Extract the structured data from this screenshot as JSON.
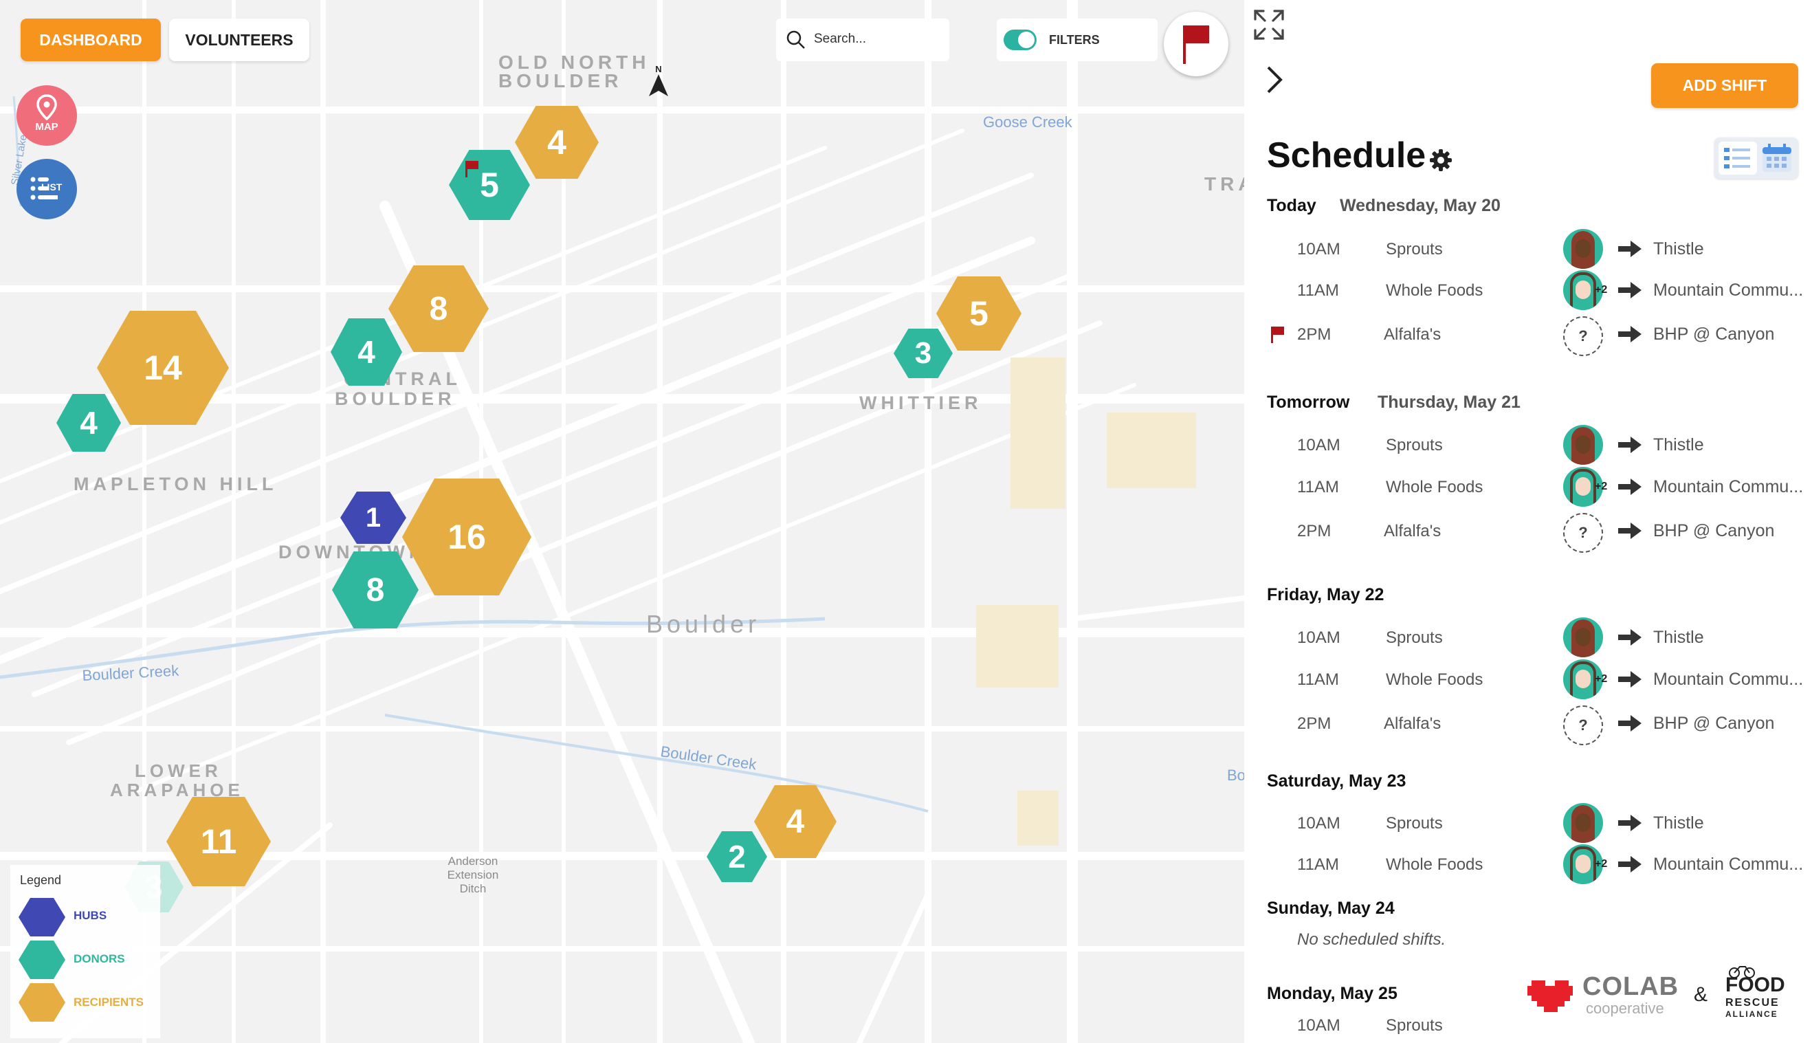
{
  "topbar": {
    "dashboard_label": "DASHBOARD",
    "volunteers_label": "VOLUNTEERS",
    "search_placeholder": "Search...",
    "filters_label": "FILTERS",
    "filters_enabled": true
  },
  "side_buttons": {
    "map_label": "MAP",
    "list_label": "LIST"
  },
  "map": {
    "place_labels": [
      "OLD NORTH",
      "BOULDER",
      "Goose Creek",
      "TRA",
      "CENTRAL",
      "BOULDER",
      "WHITTIER",
      "MAPLETON HILL",
      "DOWNTOWN",
      "Boulder",
      "Boulder Creek",
      "Boulder Creek",
      "LOWER",
      "ARAPAHOE",
      "Anderson",
      "Extension",
      "Ditch",
      "Silver Lake Ditch",
      "Bo",
      "N"
    ],
    "clusters": [
      {
        "type": "recipient",
        "count": "4"
      },
      {
        "type": "donor",
        "count": "5",
        "flag": true
      },
      {
        "type": "recipient",
        "count": "8"
      },
      {
        "type": "donor",
        "count": "4"
      },
      {
        "type": "recipient",
        "count": "14"
      },
      {
        "type": "donor",
        "count": "4"
      },
      {
        "type": "recipient",
        "count": "5"
      },
      {
        "type": "donor",
        "count": "3"
      },
      {
        "type": "hub",
        "count": "1"
      },
      {
        "type": "recipient",
        "count": "16"
      },
      {
        "type": "donor",
        "count": "8"
      },
      {
        "type": "recipient",
        "count": "4"
      },
      {
        "type": "donor",
        "count": "2"
      },
      {
        "type": "recipient",
        "count": "11"
      },
      {
        "type": "donor",
        "count": "3",
        "faded": true
      }
    ],
    "legend": {
      "title": "Legend",
      "items": [
        {
          "label": "HUBS",
          "color": "#3f48b3"
        },
        {
          "label": "DONORS",
          "color": "#2fb89e"
        },
        {
          "label": "RECIPIENTS",
          "color": "#e5ad42"
        }
      ]
    }
  },
  "panel": {
    "add_shift_label": "ADD SHIFT",
    "title": "Schedule",
    "days": [
      {
        "header": "Today",
        "date": "Wednesday, May 20",
        "shifts": [
          {
            "time": "10AM",
            "donor": "Sprouts",
            "recipient": "Thistle"
          },
          {
            "time": "11AM",
            "donor": "Whole Foods",
            "extra": "+2",
            "recipient": "Mountain Commu..."
          },
          {
            "time": "2PM",
            "donor": "Alfalfa's",
            "unassigned": "?",
            "recipient": "BHP @ Canyon",
            "flag": true
          }
        ]
      },
      {
        "header": "Tomorrow",
        "date": "Thursday, May 21",
        "shifts": [
          {
            "time": "10AM",
            "donor": "Sprouts",
            "recipient": "Thistle"
          },
          {
            "time": "11AM",
            "donor": "Whole Foods",
            "extra": "+2",
            "recipient": "Mountain Commu..."
          },
          {
            "time": "2PM",
            "donor": "Alfalfa's",
            "unassigned": "?",
            "recipient": "BHP @ Canyon"
          }
        ]
      },
      {
        "header": "Friday, May 22",
        "shifts": [
          {
            "time": "10AM",
            "donor": "Sprouts",
            "recipient": "Thistle"
          },
          {
            "time": "11AM",
            "donor": "Whole Foods",
            "extra": "+2",
            "recipient": "Mountain Commu..."
          },
          {
            "time": "2PM",
            "donor": "Alfalfa's",
            "unassigned": "?",
            "recipient": "BHP @ Canyon"
          }
        ]
      },
      {
        "header": "Saturday, May 23",
        "shifts": [
          {
            "time": "10AM",
            "donor": "Sprouts",
            "recipient": "Thistle"
          },
          {
            "time": "11AM",
            "donor": "Whole Foods",
            "extra": "+2",
            "recipient": "Mountain Commu..."
          }
        ]
      },
      {
        "header": "Sunday, May 24",
        "empty_text": "No scheduled shifts."
      },
      {
        "header": "Monday, May 25",
        "shifts": [
          {
            "time": "10AM",
            "donor": "Sprouts"
          }
        ]
      }
    ]
  },
  "branding": {
    "colab_name": "COLAB",
    "colab_sub": "cooperative",
    "ampersand": "&",
    "frc_line1": "FOOD",
    "frc_line2": "RESCUE",
    "frc_line3": "ALLIANCE"
  },
  "colors": {
    "accent": "#f7941d",
    "donor": "#2fb89e",
    "recipient": "#e5ad42",
    "hub": "#3f48b3",
    "flag": "#b3141b",
    "colab_red": "#e8202a"
  }
}
